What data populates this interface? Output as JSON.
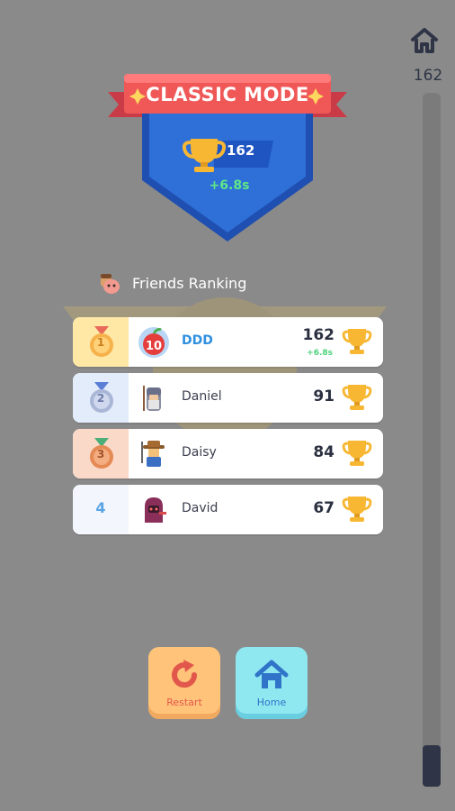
{
  "header": {
    "top_score": "162"
  },
  "progress": {
    "fraction": 0.06
  },
  "badge": {
    "mode_title": "CLASSIC MODE",
    "score": "162",
    "time_delta": "+6.8s"
  },
  "friends_ranking": {
    "title": "Friends Ranking",
    "rows": [
      {
        "rank": "1",
        "name": "DDD",
        "score": "162",
        "sub": "+6.8s",
        "avatar_badge": "10"
      },
      {
        "rank": "2",
        "name": "Daniel",
        "score": "91"
      },
      {
        "rank": "3",
        "name": "Daisy",
        "score": "84"
      },
      {
        "rank": "4",
        "name": "David",
        "score": "67"
      }
    ]
  },
  "buttons": {
    "restart_label": "Restart",
    "home_label": "Home"
  },
  "colors": {
    "background": "#8a8a8a",
    "ribbon": "#f05858",
    "shield": "#2f6fd8",
    "gold": "#f7b733",
    "green": "#5ee887"
  },
  "icons": [
    "home-icon",
    "trophy-icon",
    "medal-icon",
    "restart-icon",
    "friends-icon"
  ]
}
